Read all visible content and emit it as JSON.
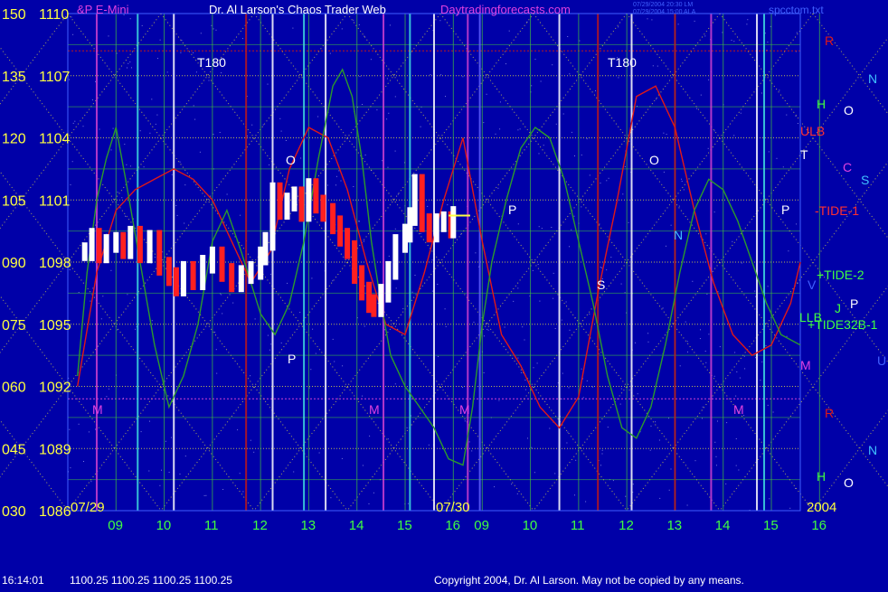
{
  "header": {
    "instrument": "&P E-Mini",
    "title": "Dr. Al Larson's Chaos Trader Web",
    "site": "Daytradingforecasts.com",
    "stamp_line1": "07/29/2004 20:30 LM",
    "stamp_line2": "07/29/2004 15:00 ALA",
    "file": "spcctom.txt"
  },
  "footer": {
    "time": "16:14:01",
    "quote": "1100.25 1100.25 1100.25 1100.25",
    "copyright": "Copyright 2004, Dr. Al Larson. May not be copied by any means."
  },
  "colors": {
    "background": "#0000a8",
    "price_up": "#ffffff",
    "price_down": "#ff2020",
    "flux_line": "#2c9a2c",
    "red_line": "#e01818",
    "price_grid": "#e8e040",
    "time_grid_green": "#40c040",
    "time_grid_yellow": "#e8e040",
    "event_magenta": "#d040d0",
    "event_red": "#c01818",
    "event_white": "#ffffff",
    "event_cyan": "#40e0e0",
    "event_blue": "#6060ff",
    "axis_text": "#ffff40",
    "hour_text": "#40ff40"
  },
  "chart_data": {
    "type": "line",
    "title": "Dr. Al Larson's Chaos Trader Web",
    "left_axis_scale": [
      "150",
      "135",
      "120",
      "105",
      "090",
      "075",
      "060",
      "045",
      "030"
    ],
    "right_price_scale": [
      "1110",
      "1107",
      "1104",
      "1101",
      "1098",
      "1095",
      "1092",
      "1089",
      "1086"
    ],
    "ylim": [
      1086,
      1110
    ],
    "hour_ticks": [
      "09",
      "10",
      "11",
      "12",
      "13",
      "14",
      "15",
      "16",
      "09",
      "10",
      "11",
      "12",
      "13",
      "14",
      "15",
      "16"
    ],
    "date_labels": [
      "07/29",
      "07/30",
      "2004"
    ],
    "chart_labels": [
      "T180",
      "T180",
      "O",
      "P",
      "O",
      "P",
      "S",
      "M",
      "M",
      "M",
      "M",
      "N",
      "P"
    ],
    "legend_labels": [
      {
        "text": "R",
        "color": "#e01818"
      },
      {
        "text": "N",
        "color": "#40c0ff"
      },
      {
        "text": "H",
        "color": "#40ff40"
      },
      {
        "text": "O",
        "color": "#ffffff"
      },
      {
        "text": "ULB",
        "color": "#ff3030"
      },
      {
        "text": "T",
        "color": "#ffffff"
      },
      {
        "text": "C",
        "color": "#e040e0"
      },
      {
        "text": "S",
        "color": "#40c0ff"
      },
      {
        "text": "-TIDE-1",
        "color": "#ff3030"
      },
      {
        "text": "+TIDE-2",
        "color": "#40ff40"
      },
      {
        "text": "V",
        "color": "#4060ff"
      },
      {
        "text": "P",
        "color": "#ffffff"
      },
      {
        "text": "LLB",
        "color": "#40ff40"
      },
      {
        "text": "J",
        "color": "#40ff40"
      },
      {
        "text": "+TIDE32B-1",
        "color": "#40ff40"
      },
      {
        "text": "M",
        "color": "#e040e0"
      },
      {
        "text": "U",
        "color": "#4060ff"
      },
      {
        "text": "R",
        "color": "#e01818"
      },
      {
        "text": "N",
        "color": "#40c0ff"
      },
      {
        "text": "H",
        "color": "#40ff40"
      },
      {
        "text": "O",
        "color": "#ffffff"
      }
    ],
    "price_series": {
      "name": "S&P E-Mini",
      "sessions": [
        1,
        1,
        1,
        1,
        1,
        1,
        1,
        1,
        1,
        1,
        1,
        1,
        1,
        1,
        1,
        1,
        1,
        1,
        1,
        1,
        1,
        1,
        1,
        1,
        1,
        1,
        1,
        1,
        1,
        1,
        1,
        1,
        1,
        1,
        1,
        1,
        1,
        1,
        1,
        1,
        1,
        1,
        1,
        1,
        1,
        1,
        1,
        1,
        1
      ],
      "x": [
        8.35,
        8.5,
        8.65,
        8.8,
        9.0,
        9.15,
        9.3,
        9.5,
        9.7,
        9.9,
        10.1,
        10.25,
        10.4,
        10.6,
        10.8,
        11.0,
        11.2,
        11.4,
        11.6,
        11.8,
        12.0,
        12.1,
        12.25,
        12.4,
        12.55,
        12.7,
        12.85,
        13.0,
        13.15,
        13.3,
        13.5,
        13.65,
        13.8,
        13.95,
        14.1,
        14.25,
        14.35,
        14.5,
        14.65,
        14.8,
        15.0,
        15.1,
        15.2,
        15.35,
        15.5,
        15.65,
        15.8,
        15.95,
        16.0
      ],
      "values": [
        1098.5,
        1099.2,
        1098.4,
        1098.9,
        1099.0,
        1098.6,
        1099.3,
        1098.4,
        1099.1,
        1097.8,
        1097.3,
        1096.8,
        1097.6,
        1097.1,
        1097.9,
        1098.3,
        1097.5,
        1097.0,
        1097.4,
        1097.6,
        1098.3,
        1099.0,
        1101.4,
        1100.5,
        1100.9,
        1101.2,
        1100.4,
        1101.6,
        1100.8,
        1100.4,
        1099.8,
        1099.2,
        1098.6,
        1097.4,
        1096.6,
        1096.0,
        1095.8,
        1096.5,
        1097.6,
        1098.9,
        1099.4,
        1100.2,
        1101.8,
        1099.9,
        1099.4,
        1099.9,
        1100.0,
        1099.6,
        1100.25
      ]
    },
    "flux_series": {
      "name": "+TIDE-2",
      "x": [
        8.2,
        8.4,
        8.6,
        8.8,
        9.0,
        9.2,
        9.5,
        9.8,
        10.1,
        10.4,
        10.7,
        11.0,
        11.3,
        11.6,
        12.0,
        12.3,
        12.6,
        12.9,
        13.2,
        13.5,
        13.7,
        13.9,
        14.1,
        14.3,
        14.5,
        14.7,
        15.0,
        15.3,
        15.6,
        15.9,
        16.2,
        16.4,
        16.6,
        16.8,
        17.1,
        17.4,
        17.7,
        18.0,
        18.3,
        18.6,
        18.9,
        19.2,
        19.5,
        19.8,
        20.1,
        20.4,
        20.7,
        21.0,
        21.3,
        21.6,
        21.9,
        22.2,
        22.5,
        22.8,
        23.2
      ],
      "values": [
        1092.5,
        1097.5,
        1101.0,
        1103.0,
        1104.5,
        1102.0,
        1098.0,
        1094.0,
        1091.0,
        1092.5,
        1095.0,
        1099.0,
        1100.5,
        1098.5,
        1095.5,
        1094.5,
        1096.0,
        1099.0,
        1103.0,
        1106.5,
        1107.3,
        1106.0,
        1103.0,
        1099.0,
        1096.0,
        1093.5,
        1092.0,
        1091.0,
        1090.0,
        1088.5,
        1088.2,
        1091.0,
        1095.0,
        1098.0,
        1101.0,
        1103.5,
        1104.5,
        1104.0,
        1102.0,
        1099.0,
        1096.0,
        1092.5,
        1090.0,
        1089.5,
        1091.0,
        1094.0,
        1097.5,
        1100.5,
        1102.0,
        1101.5,
        1100.0,
        1098.0,
        1096.0,
        1094.5,
        1094.0
      ]
    },
    "red_series": {
      "name": "-TIDE-1",
      "x": [
        8.2,
        8.6,
        9.0,
        9.4,
        9.8,
        10.2,
        10.6,
        11.0,
        11.4,
        11.8,
        12.2,
        12.6,
        13.0,
        13.4,
        13.8,
        14.2,
        14.6,
        15.0,
        15.4,
        15.8,
        16.2,
        16.6,
        17.0,
        17.4,
        17.8,
        18.2,
        18.6,
        19.0,
        19.4,
        19.8,
        20.2,
        20.6,
        21.0,
        21.4,
        21.8,
        22.2,
        22.6,
        23.0,
        23.2
      ],
      "values": [
        1092.0,
        1097.5,
        1100.5,
        1101.5,
        1102.0,
        1102.5,
        1102.0,
        1101.0,
        1099.0,
        1097.0,
        1098.5,
        1102.5,
        1104.5,
        1104.0,
        1101.5,
        1098.0,
        1095.0,
        1094.5,
        1097.5,
        1101.0,
        1104.0,
        1099.0,
        1094.5,
        1093.0,
        1091.0,
        1090.0,
        1091.5,
        1096.5,
        1101.0,
        1106.0,
        1106.5,
        1104.5,
        1100.5,
        1097.0,
        1094.5,
        1093.5,
        1094.0,
        1096.0,
        1098.0
      ]
    },
    "xlim": [
      8.0,
      23.2
    ],
    "grid": true,
    "legend": "right"
  }
}
